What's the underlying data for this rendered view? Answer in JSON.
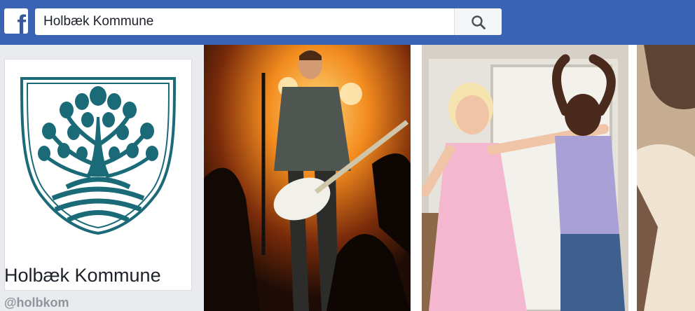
{
  "header": {
    "logo_icon": "facebook-f-icon",
    "search": {
      "value": "Holbæk Kommune",
      "button_icon": "search-icon"
    },
    "brand_color": "#3b63b4"
  },
  "page": {
    "name": "Holbæk Kommune",
    "handle": "@holbkom",
    "profile_image": "coat-of-arms-tree-and-waves",
    "accent_color": "#1a6a78"
  },
  "cover": {
    "photos": [
      {
        "icon": "concert-guitarist-photo"
      },
      {
        "icon": "dancing-children-photo"
      },
      {
        "icon": "partial-figure-photo"
      }
    ]
  }
}
